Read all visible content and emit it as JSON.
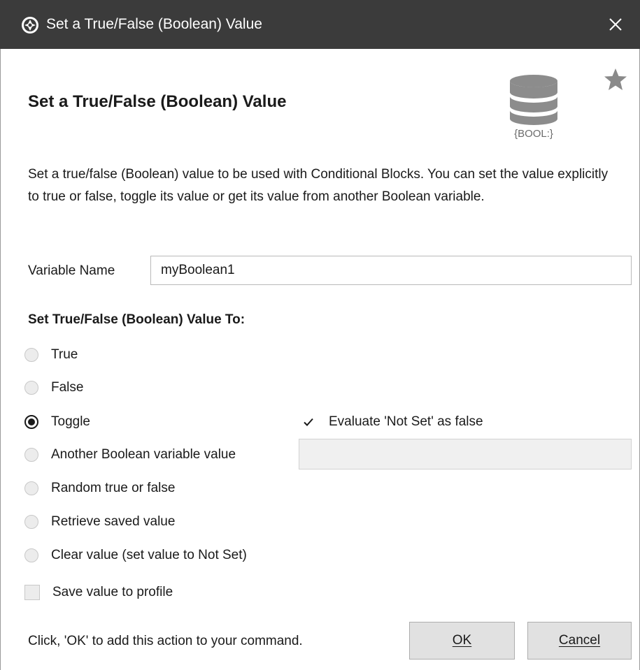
{
  "window": {
    "title": "Set a True/False (Boolean) Value",
    "close_glyph": "✕"
  },
  "header": {
    "heading": "Set a True/False (Boolean) Value",
    "icon_caption": "{BOOL:}",
    "icon_name": "database-icon",
    "favorite_icon": "star-icon"
  },
  "description": "Set a true/false (Boolean) value to be used with Conditional Blocks.  You can set the value explicitly to true or false, toggle its value or get its value from another Boolean variable.",
  "variable": {
    "label": "Variable Name",
    "value": "myBoolean1"
  },
  "options_heading": "Set True/False (Boolean) Value To:",
  "options": [
    {
      "label": "True",
      "checked": false
    },
    {
      "label": "False",
      "checked": false
    },
    {
      "label": "Toggle",
      "checked": true
    },
    {
      "label": "Another Boolean variable value",
      "checked": false
    },
    {
      "label": "Random true or false",
      "checked": false
    },
    {
      "label": "Retrieve saved value",
      "checked": false
    },
    {
      "label": "Clear value (set value to Not Set)",
      "checked": false
    }
  ],
  "evaluate_not_set": {
    "label": "Evaluate 'Not Set' as false",
    "checked": true
  },
  "other_variable": {
    "value": ""
  },
  "save_to_profile": {
    "label": "Save value to profile",
    "checked": false
  },
  "footer": {
    "hint": "Click, 'OK' to add this action to your command.",
    "ok_label": "OK",
    "cancel_label": "Cancel"
  },
  "colors": {
    "titlebar": "#3b3b3b",
    "icon_gray": "#8c8c8c",
    "button_face": "#e1e1e1"
  }
}
